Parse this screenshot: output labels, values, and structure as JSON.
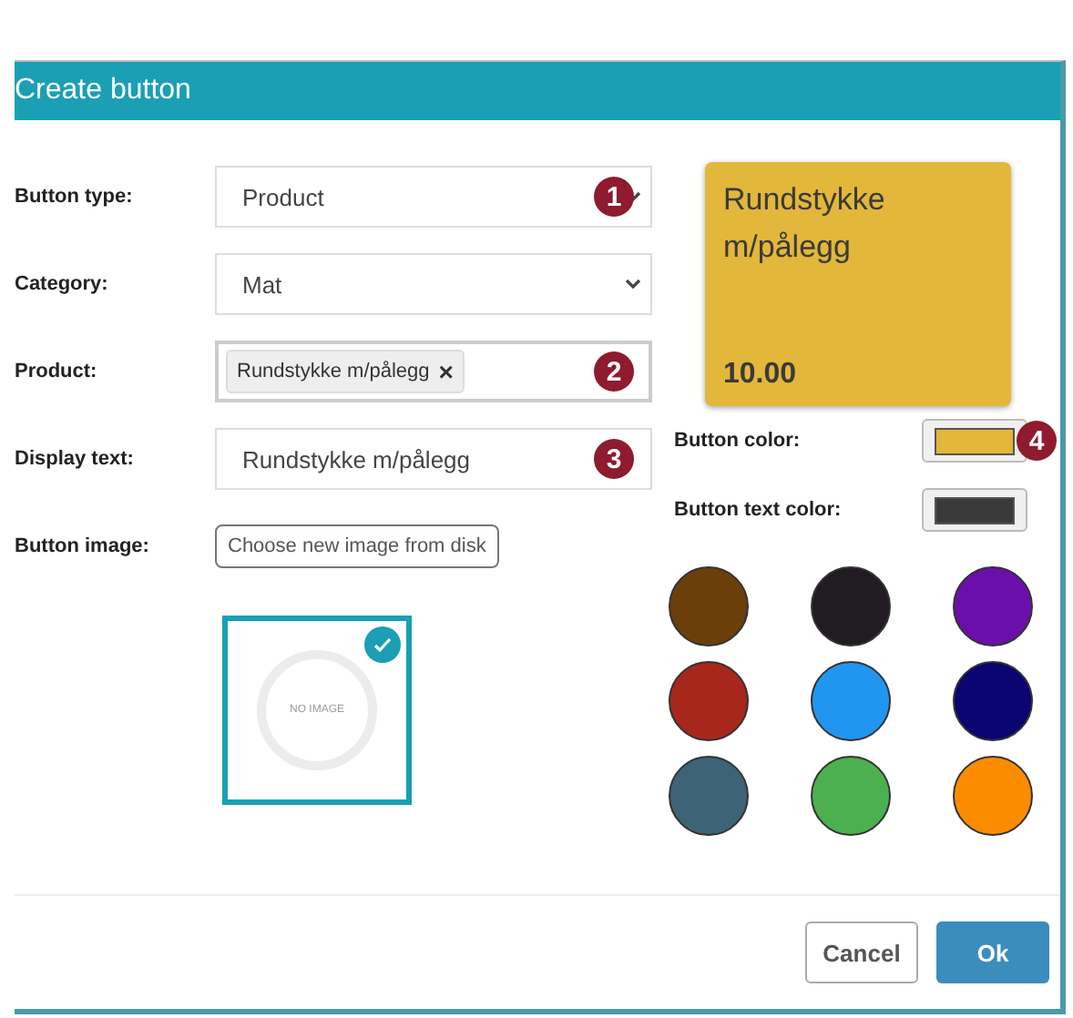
{
  "dialog": {
    "title": "Create button"
  },
  "fields": [
    {
      "kind": "select",
      "label": "Button type:",
      "value": "Product",
      "marker": "1"
    },
    {
      "kind": "select",
      "label": "Category:",
      "value": "Mat"
    },
    {
      "kind": "tags",
      "label": "Product:",
      "tags": [
        "Rundstykke m/pålegg"
      ],
      "remove": "×",
      "marker": "2"
    },
    {
      "kind": "text",
      "label": "Display text:",
      "value": "Rundstykke m/pålegg",
      "marker": "3"
    },
    {
      "kind": "file",
      "label": "Button image:",
      "button": "Choose new image from disk"
    }
  ],
  "image_tile": {
    "text": "NO IMAGE",
    "selected": true
  },
  "preview": {
    "title": "Rundstykke m/pålegg",
    "price": "10.00"
  },
  "button_color": {
    "label": "Button color:",
    "color": "#e2b73a",
    "marker": "4"
  },
  "button_text_color": {
    "label": "Button text color:",
    "color": "#3a3a3a"
  },
  "palette": [
    {
      "color": "#6b3f0a"
    },
    {
      "color": "#211c22"
    },
    {
      "color": "#6a0fab"
    },
    {
      "color": "#a8271c"
    },
    {
      "color": "#2196f0"
    },
    {
      "color": "#0a0570"
    },
    {
      "color": "#3d6376"
    },
    {
      "color": "#4caf50"
    },
    {
      "color": "#fb8c00"
    }
  ],
  "buttons": [
    {
      "kind": "secondary",
      "label": "Cancel"
    },
    {
      "kind": "primary",
      "label": "Ok"
    }
  ]
}
